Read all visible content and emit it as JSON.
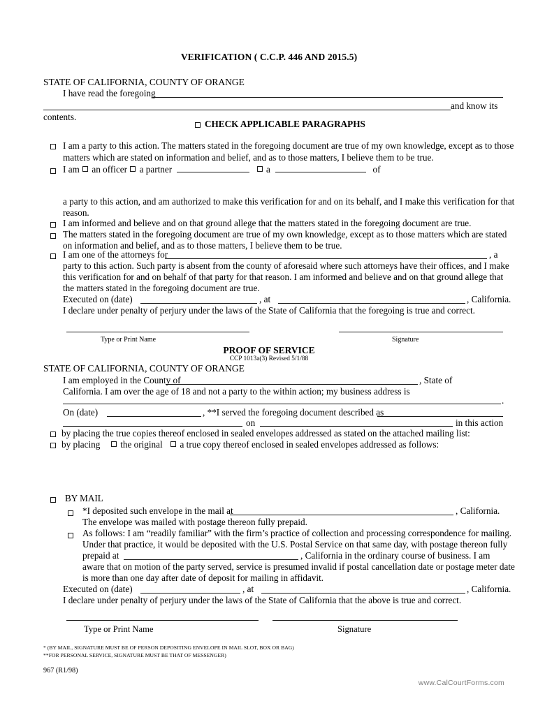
{
  "document": {
    "title": "VERIFICATION   ( C.C.P. 446 AND 2015.5)",
    "form_number": "967 (R1/98)",
    "footer_url": "www.CalCourtForms.com"
  },
  "verification": {
    "state_county": "STATE OF CALIFORNIA, COUNTY OF ORANGE",
    "read_foregoing_label": "I have read the foregoing",
    "and_know_its": "and know its",
    "contents": "contents.",
    "check_applicable_heading": "CHECK APPLICABLE PARAGRAPHS",
    "paragraphs": [
      {
        "id": "party-to-action",
        "line1": "I am a party to this action.  The matters stated in the foregoing document are true of my own knowledge, except as to those",
        "line2": "matters which are stated on information and belief, and as to those matters, I believe them to be true."
      },
      {
        "id": "officer-partner",
        "i_am": "I am",
        "an_officer": "an officer",
        "a_partner": "a partner",
        "a_label": "a",
        "of_label": "of",
        "cont_line1": "a party to this action, and am authorized to make this verification for and on its behalf, and I make this verification for that",
        "cont_line2": "reason."
      },
      {
        "id": "informed-and-believe",
        "line1": "I am informed and believe and on that ground allege that the matters stated in the foregoing document are true."
      },
      {
        "id": "matters-stated-true",
        "line1": "The matters stated in the foregoing document are true of my own knowledge, except as to those matters which are stated",
        "line2": "on information and belief, and as to those matters, I believe them to be true."
      },
      {
        "id": "one-of-attorneys",
        "line1_pre": "I am one of the attorneys for",
        "line1_post": ", a",
        "line2": "party to this action.  Such party is absent from the county of aforesaid where such attorneys have their offices, and I make",
        "line3": "this verification for and on behalf of that party for that reason.  I am informed and believe and on that ground allege that",
        "line4": "the matters stated in the foregoing document are true."
      }
    ],
    "executed_on_label": "Executed on (date)",
    "at_label": ", at",
    "california_label": ", California.",
    "declare_line": "I declare under penalty of perjury under the laws of the State of California that the foregoing is true and correct.",
    "signature_block": {
      "name_label": "Type or Print Name",
      "signature_label": "Signature"
    }
  },
  "proof_of_service": {
    "heading": "PROOF OF SERVICE",
    "subheading": "CCP 1013a(3) Revised 5/1/88",
    "state_county": "STATE OF CALIFORNIA, COUNTY OF ORANGE",
    "employed_pre": "I am employed in the County of",
    "employed_post": ", State of",
    "over_age_line": "California.  I am over the age of 18 and not a party to the within action; my business address is",
    "period": ".",
    "on_date_label": "On (date)",
    "served_label": ", **I served the foregoing document described as",
    "on_label": "on",
    "in_this_action": "in this action",
    "options": [
      {
        "id": "sealed-envelopes-mailing-list",
        "text": "by placing the true copies thereof enclosed in sealed envelopes addressed as stated on the attached mailing list:"
      },
      {
        "id": "by-placing-original-or-copy",
        "by_placing": "by placing",
        "the_original": "the original",
        "true_copy": "a true copy thereof enclosed in sealed envelopes addressed as follows:"
      }
    ],
    "by_mail": {
      "heading": "BY MAIL",
      "deposited": {
        "pre": "*I deposited such envelope in the mail at",
        "post": ", California.",
        "line2": "The envelope was mailed with postage thereon fully prepaid."
      },
      "as_follows": {
        "line1": "As follows: I am “readily familiar” with the firm’s practice of collection and processing correspondence for mailing.",
        "line2": "Under that practice, it would be deposited with the U.S. Postal Service on that same day, with postage thereon fully",
        "line3_pre": "prepaid at",
        "line3_post": ", California in the ordinary course of business.  I am",
        "line4": "aware that on motion of the party served, service is presumed invalid if postal cancellation date or postage meter date",
        "line5": "is more than one day after date of deposit for mailing in affidavit."
      }
    },
    "executed_on_label": "Executed on (date)",
    "at_label": ", at",
    "california_label": ", California.",
    "declare_line": "I declare under penalty of perjury under the laws of the State of California that the above is true and correct.",
    "signature_block": {
      "name_label": "Type or Print Name",
      "signature_label": "Signature"
    }
  },
  "footnotes": {
    "single_star": "* (BY MAIL, SIGNATURE MUST BE OF PERSON DEPOSITING ENVELOPE IN MAIL SLOT, BOX OR BAG)",
    "double_star": "**FOR PERSONAL SERVICE, SIGNATURE MUST BE THAT OF MESSENGER)"
  }
}
